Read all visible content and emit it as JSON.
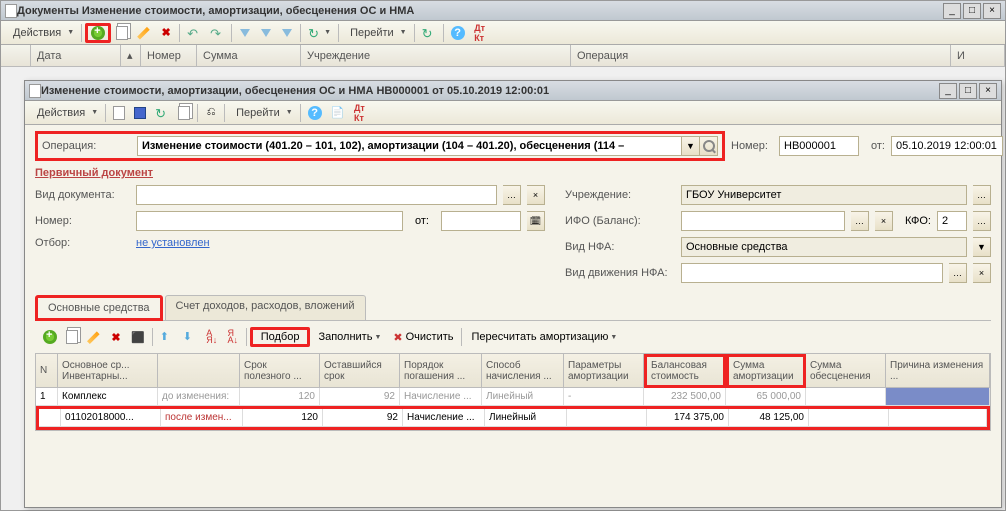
{
  "outer": {
    "title": "Документы Изменение стоимости, амортизации, обесценения ОС и НМА",
    "actions_label": "Действия",
    "goto_label": "Перейти"
  },
  "list_header": {
    "date": "Дата",
    "number": "Номер",
    "sum": "Сумма",
    "institution": "Учреждение",
    "operation": "Операция",
    "last": "И"
  },
  "doc": {
    "title": "Изменение стоимости, амортизации, обесценения ОС и НМА НВ000001 от 05.10.2019 12:00:01",
    "actions_label": "Действия",
    "goto_label": "Перейти",
    "operation_label": "Операция:",
    "operation_value": "Изменение стоимости (401.20 – 101, 102), амортизации (104 – 401.20), обесценения (114 –",
    "number_label": "Номер:",
    "number_value": "НВ000001",
    "date_label": "от:",
    "date_value": "05.10.2019 12:00:01",
    "section_title": "Первичный документ",
    "doc_type_label": "Вид документа:",
    "doc_num_label": "Номер:",
    "doc_date_label": "от:",
    "institution_label": "Учреждение:",
    "institution_value": "ГБОУ Университет",
    "ifo_label": "ИФО (Баланс):",
    "kfo_label": "КФО:",
    "kfo_value": "2",
    "nfa_type_label": "Вид НФА:",
    "nfa_type_value": "Основные средства",
    "nfa_move_label": "Вид движения НФА:",
    "filter_label": "Отбор:",
    "filter_value": "не установлен"
  },
  "tabs": {
    "t1": "Основные средства",
    "t2": "Счет доходов, расходов, вложений"
  },
  "inner_tb": {
    "podbor": "Подбор",
    "fill": "Заполнить",
    "clear": "Очистить",
    "recalc": "Пересчитать амортизацию"
  },
  "cols": {
    "n": "N",
    "main": "Основное ср...",
    "inv": "Инвентарны...",
    "term": "Срок полезного ...",
    "remain": "Оставшийся срок",
    "order": "Порядок погашения ...",
    "method": "Способ начисления ...",
    "params": "Параметры амортизации",
    "balance": "Балансовая стоимость",
    "amort": "Сумма амортизации",
    "depr": "Сумма обесценения",
    "reason": "Причина изменения ..."
  },
  "rows": {
    "r1": {
      "n": "1",
      "main": "Комплекс",
      "inv": "01102018000...",
      "state1": "до изменения:",
      "state2": "после измен...",
      "term1": "120",
      "term2": "120",
      "remain1": "92",
      "remain2": "92",
      "order1": "Начисление ...",
      "order2": "Начисление ...",
      "method1": "Линейный",
      "method2": "Линейный",
      "params1": "-",
      "balance1": "232 500,00",
      "balance2": "174 375,00",
      "amort1": "65 000,00",
      "amort2": "48 125,00"
    }
  }
}
